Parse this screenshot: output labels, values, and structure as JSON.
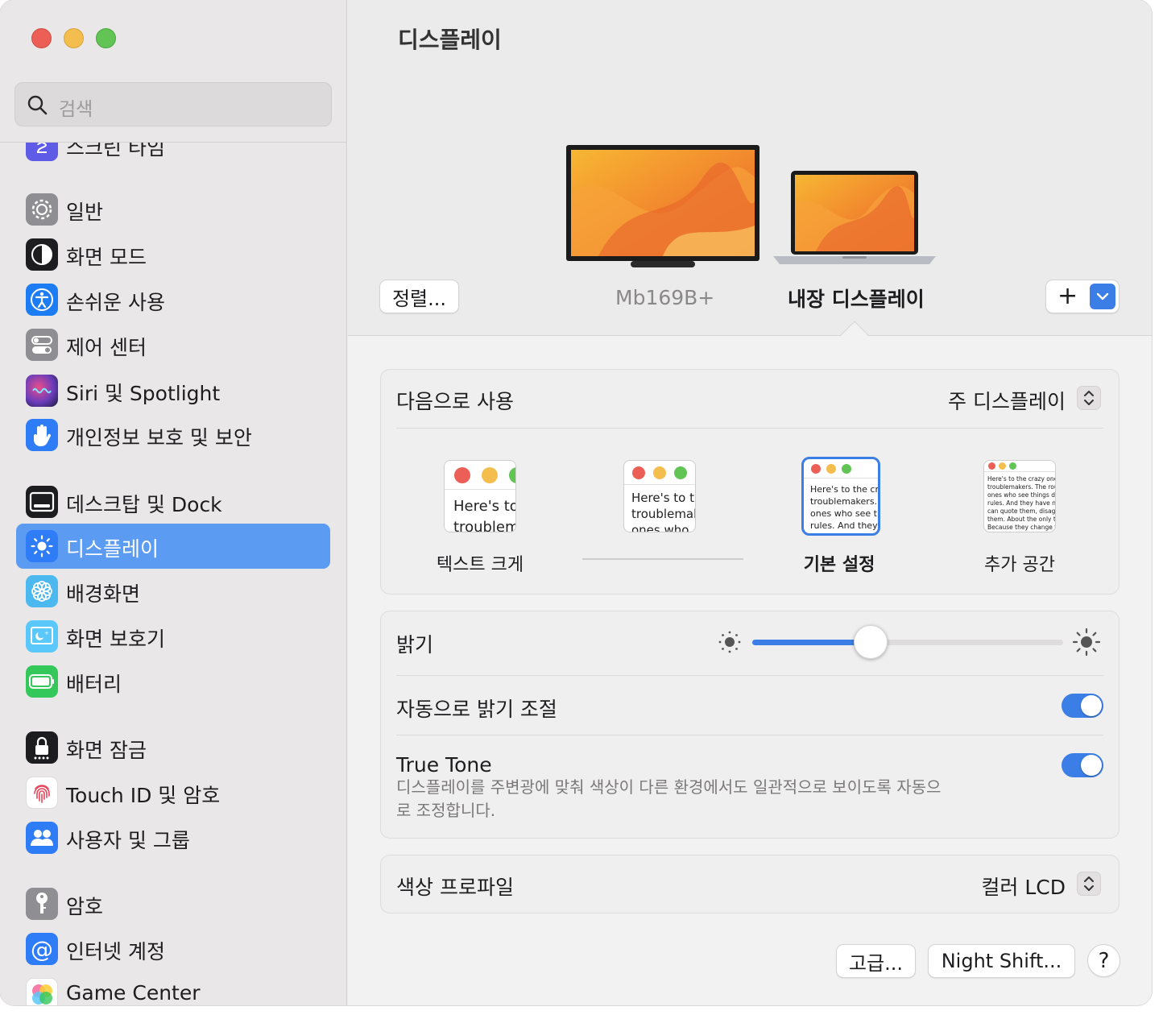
{
  "window": {
    "traffic_lights": [
      "close",
      "minimize",
      "zoom"
    ]
  },
  "sidebar": {
    "search_placeholder": "검색",
    "items": [
      {
        "label": "스크린 타임",
        "icon": "hourglass-icon",
        "color": "#5e5ce6"
      },
      {
        "label": "일반",
        "icon": "gear-icon",
        "color": "#8e8e93"
      },
      {
        "label": "화면 모드",
        "icon": "appearance-icon",
        "color": "#1d1d1f"
      },
      {
        "label": "손쉬운 사용",
        "icon": "accessibility-icon",
        "color": "#1c7cf4"
      },
      {
        "label": "제어 센터",
        "icon": "control-center-icon",
        "color": "#8e8e93"
      },
      {
        "label": "Siri 및 Spotlight",
        "icon": "siri-icon",
        "color": "#6a3dbb"
      },
      {
        "label": "개인정보 보호 및 보안",
        "icon": "hand-icon",
        "color": "#2e7cf6"
      },
      {
        "label": "데스크탑 및 Dock",
        "icon": "dock-icon",
        "color": "#1d1d1f"
      },
      {
        "label": "디스플레이",
        "icon": "sun-icon",
        "color": "#2e7cf6"
      },
      {
        "label": "배경화면",
        "icon": "flower-icon",
        "color": "#4cb8f0"
      },
      {
        "label": "화면 보호기",
        "icon": "screensaver-icon",
        "color": "#5ac8fa"
      },
      {
        "label": "배터리",
        "icon": "battery-icon",
        "color": "#34c759"
      },
      {
        "label": "화면 잠금",
        "icon": "lock-icon",
        "color": "#1d1d1f"
      },
      {
        "label": "Touch ID 및 암호",
        "icon": "fingerprint-icon",
        "color": "#ffffff"
      },
      {
        "label": "사용자 및 그룹",
        "icon": "users-icon",
        "color": "#2e7cf6"
      },
      {
        "label": "암호",
        "icon": "key-icon",
        "color": "#8e8e93"
      },
      {
        "label": "인터넷 계정",
        "icon": "at-icon",
        "color": "#2e7cf6"
      },
      {
        "label": "Game Center",
        "icon": "game-center-icon",
        "color": "#ffffff"
      }
    ],
    "active": "디스플레이"
  },
  "main": {
    "title": "디스플레이",
    "arrange_button": "정렬...",
    "displays": [
      {
        "name": "Mb169B+",
        "selected": false
      },
      {
        "name": "내장 디스플레이",
        "selected": true
      }
    ],
    "add_button": "+",
    "use_as": {
      "label": "다음으로 사용",
      "value": "주 디스플레이"
    },
    "resolution_options": [
      {
        "label": "텍스트 크게",
        "preview": "Here's to the crazy ones\ntroublemakers.\nones who see"
      },
      {
        "label": "",
        "preview": "Here's to the crazy\ntroublemakers.\nones who"
      },
      {
        "label": "기본 설정",
        "preview": "Here's to the crazy\ntroublemakers. The\nones who see things\nrules. And they have"
      },
      {
        "label": "추가 공간",
        "preview": "Here's to the crazy ones\ntroublemakers. The round\nones who see things different\nrules. And they have no\ncan quote them, disagree\nthem. About the only thing\nBecause they change things"
      }
    ],
    "selected_resolution": "기본 설정",
    "brightness": {
      "label": "밝기",
      "value": 0.38
    },
    "auto_brightness": {
      "label": "자동으로 밝기 조절",
      "on": true
    },
    "true_tone": {
      "label": "True Tone",
      "on": true,
      "description": "디스플레이를 주변광에 맞춰 색상이 다른 환경에서도 일관적으로 보이도록 자동으로 조정합니다."
    },
    "color_profile": {
      "label": "색상 프로파일",
      "value": "컬러 LCD"
    },
    "advanced_button": "고급...",
    "night_shift_button": "Night Shift...",
    "help_button": "?"
  },
  "colors": {
    "accent": "#3a7ee6",
    "sidebar_selected": "#5b9cf2"
  }
}
